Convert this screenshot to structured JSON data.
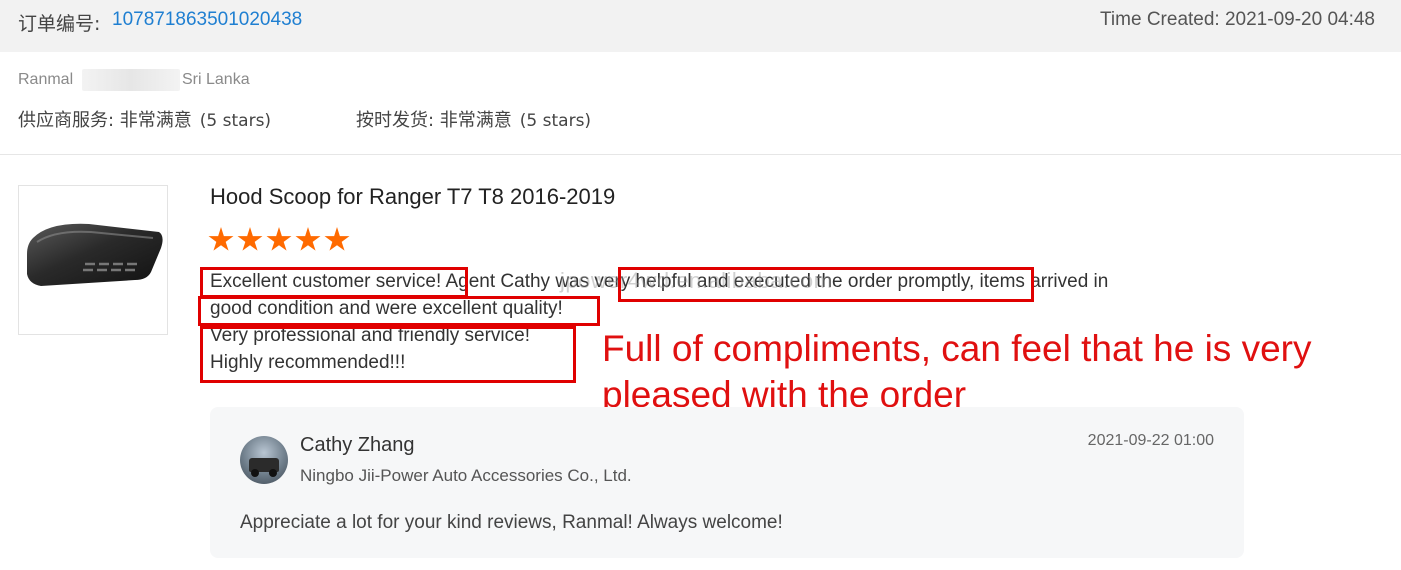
{
  "header": {
    "order_label": "订单编号:",
    "order_number": "107871863501020438",
    "time_created": "Time Created: 2021-09-20 04:48"
  },
  "buyer": {
    "name": "Ranmal",
    "country": "Sri Lanka"
  },
  "ratings": {
    "supplier_service": "供应商服务: 非常满意",
    "supplier_service_stars": "(5 stars)",
    "on_time_delivery": "按时发货: 非常满意",
    "on_time_delivery_stars": "(5 stars)"
  },
  "product": {
    "title": "Hood Scoop for Ranger T7 T8 2016-2019",
    "star_rating": 5,
    "thumbnail_icon": "hood-scoop-image"
  },
  "review": {
    "line1": "Excellent customer service! Agent Cathy was very helpful and executed the order promptly, items arrived in",
    "line2": "good condition and were excellent quality!",
    "line3": "Very professional and friendly service!",
    "line4": "Highly recommended!!!"
  },
  "watermark": "jpower4wd.en.alibaba.com",
  "annotation": "Full of compliments, can feel that he is very pleased with the order",
  "reply": {
    "name": "Cathy Zhang",
    "company": "Ningbo Jii-Power Auto Accessories Co., Ltd.",
    "date": "2021-09-22 01:00",
    "text": "Appreciate a lot for your kind reviews, Ranmal!  Always welcome!"
  },
  "colors": {
    "order_link": "#1f7fd1",
    "star": "#ff6a00",
    "highlight": "#e00000",
    "annotation": "#e01010"
  }
}
